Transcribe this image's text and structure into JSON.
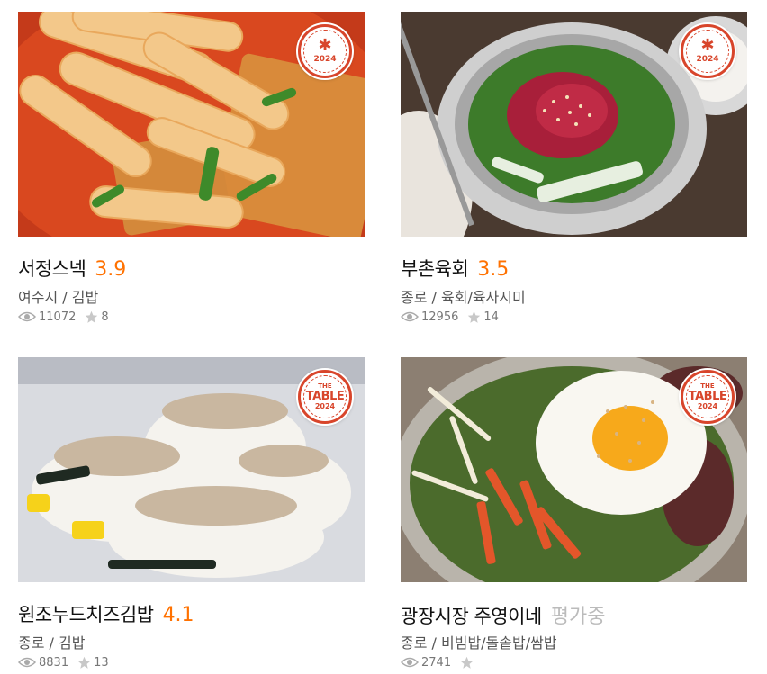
{
  "restaurants": [
    {
      "name": "서정스넥",
      "score": "3.9",
      "meta": "여수시 / 김밥",
      "views": "11072",
      "reviews": "8",
      "badge": {
        "type": "star",
        "year": "2024"
      }
    },
    {
      "name": "부촌육회",
      "score": "3.5",
      "meta": "종로 / 육회/육사시미",
      "views": "12956",
      "reviews": "14",
      "badge": {
        "type": "star",
        "year": "2024"
      }
    },
    {
      "name": "원조누드치즈김밥",
      "score": "4.1",
      "meta": "종로 / 김밥",
      "views": "8831",
      "reviews": "13",
      "badge": {
        "type": "table",
        "the": "THE",
        "label": "TABLE",
        "year": "2024"
      }
    },
    {
      "name": "광장시장 주영이네",
      "score": "평가중",
      "meta": "종로 / 비빔밥/돌솥밥/쌈밥",
      "views": "2741",
      "reviews": "",
      "badge": {
        "type": "table",
        "the": "THE",
        "label": "TABLE",
        "year": "2024"
      }
    }
  ],
  "colors": {
    "score": "#ff7100",
    "pending": "#bbbbbb",
    "badge": "#d8452b"
  }
}
